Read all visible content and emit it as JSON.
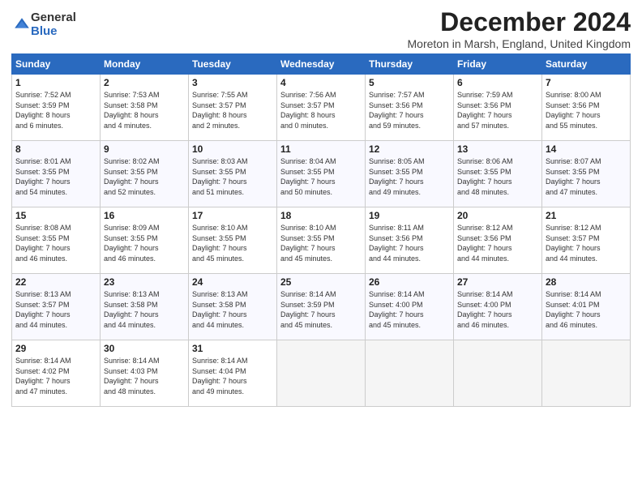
{
  "logo": {
    "general": "General",
    "blue": "Blue"
  },
  "header": {
    "month": "December 2024",
    "subtitle": "Moreton in Marsh, England, United Kingdom"
  },
  "days_of_week": [
    "Sunday",
    "Monday",
    "Tuesday",
    "Wednesday",
    "Thursday",
    "Friday",
    "Saturday"
  ],
  "weeks": [
    [
      {
        "day": "1",
        "sunrise": "7:52 AM",
        "sunset": "3:59 PM",
        "daylight": "8 hours and 6 minutes."
      },
      {
        "day": "2",
        "sunrise": "7:53 AM",
        "sunset": "3:58 PM",
        "daylight": "8 hours and 4 minutes."
      },
      {
        "day": "3",
        "sunrise": "7:55 AM",
        "sunset": "3:57 PM",
        "daylight": "8 hours and 2 minutes."
      },
      {
        "day": "4",
        "sunrise": "7:56 AM",
        "sunset": "3:57 PM",
        "daylight": "8 hours and 0 minutes."
      },
      {
        "day": "5",
        "sunrise": "7:57 AM",
        "sunset": "3:56 PM",
        "daylight": "7 hours and 59 minutes."
      },
      {
        "day": "6",
        "sunrise": "7:59 AM",
        "sunset": "3:56 PM",
        "daylight": "7 hours and 57 minutes."
      },
      {
        "day": "7",
        "sunrise": "8:00 AM",
        "sunset": "3:56 PM",
        "daylight": "7 hours and 55 minutes."
      }
    ],
    [
      {
        "day": "8",
        "sunrise": "8:01 AM",
        "sunset": "3:55 PM",
        "daylight": "7 hours and 54 minutes."
      },
      {
        "day": "9",
        "sunrise": "8:02 AM",
        "sunset": "3:55 PM",
        "daylight": "7 hours and 52 minutes."
      },
      {
        "day": "10",
        "sunrise": "8:03 AM",
        "sunset": "3:55 PM",
        "daylight": "7 hours and 51 minutes."
      },
      {
        "day": "11",
        "sunrise": "8:04 AM",
        "sunset": "3:55 PM",
        "daylight": "7 hours and 50 minutes."
      },
      {
        "day": "12",
        "sunrise": "8:05 AM",
        "sunset": "3:55 PM",
        "daylight": "7 hours and 49 minutes."
      },
      {
        "day": "13",
        "sunrise": "8:06 AM",
        "sunset": "3:55 PM",
        "daylight": "7 hours and 48 minutes."
      },
      {
        "day": "14",
        "sunrise": "8:07 AM",
        "sunset": "3:55 PM",
        "daylight": "7 hours and 47 minutes."
      }
    ],
    [
      {
        "day": "15",
        "sunrise": "8:08 AM",
        "sunset": "3:55 PM",
        "daylight": "7 hours and 46 minutes."
      },
      {
        "day": "16",
        "sunrise": "8:09 AM",
        "sunset": "3:55 PM",
        "daylight": "7 hours and 46 minutes."
      },
      {
        "day": "17",
        "sunrise": "8:10 AM",
        "sunset": "3:55 PM",
        "daylight": "7 hours and 45 minutes."
      },
      {
        "day": "18",
        "sunrise": "8:10 AM",
        "sunset": "3:55 PM",
        "daylight": "7 hours and 45 minutes."
      },
      {
        "day": "19",
        "sunrise": "8:11 AM",
        "sunset": "3:56 PM",
        "daylight": "7 hours and 44 minutes."
      },
      {
        "day": "20",
        "sunrise": "8:12 AM",
        "sunset": "3:56 PM",
        "daylight": "7 hours and 44 minutes."
      },
      {
        "day": "21",
        "sunrise": "8:12 AM",
        "sunset": "3:57 PM",
        "daylight": "7 hours and 44 minutes."
      }
    ],
    [
      {
        "day": "22",
        "sunrise": "8:13 AM",
        "sunset": "3:57 PM",
        "daylight": "7 hours and 44 minutes."
      },
      {
        "day": "23",
        "sunrise": "8:13 AM",
        "sunset": "3:58 PM",
        "daylight": "7 hours and 44 minutes."
      },
      {
        "day": "24",
        "sunrise": "8:13 AM",
        "sunset": "3:58 PM",
        "daylight": "7 hours and 44 minutes."
      },
      {
        "day": "25",
        "sunrise": "8:14 AM",
        "sunset": "3:59 PM",
        "daylight": "7 hours and 45 minutes."
      },
      {
        "day": "26",
        "sunrise": "8:14 AM",
        "sunset": "4:00 PM",
        "daylight": "7 hours and 45 minutes."
      },
      {
        "day": "27",
        "sunrise": "8:14 AM",
        "sunset": "4:00 PM",
        "daylight": "7 hours and 46 minutes."
      },
      {
        "day": "28",
        "sunrise": "8:14 AM",
        "sunset": "4:01 PM",
        "daylight": "7 hours and 46 minutes."
      }
    ],
    [
      {
        "day": "29",
        "sunrise": "8:14 AM",
        "sunset": "4:02 PM",
        "daylight": "7 hours and 47 minutes."
      },
      {
        "day": "30",
        "sunrise": "8:14 AM",
        "sunset": "4:03 PM",
        "daylight": "7 hours and 48 minutes."
      },
      {
        "day": "31",
        "sunrise": "8:14 AM",
        "sunset": "4:04 PM",
        "daylight": "7 hours and 49 minutes."
      },
      null,
      null,
      null,
      null
    ]
  ],
  "labels": {
    "sunrise": "Sunrise:",
    "sunset": "Sunset:",
    "daylight": "Daylight:"
  }
}
